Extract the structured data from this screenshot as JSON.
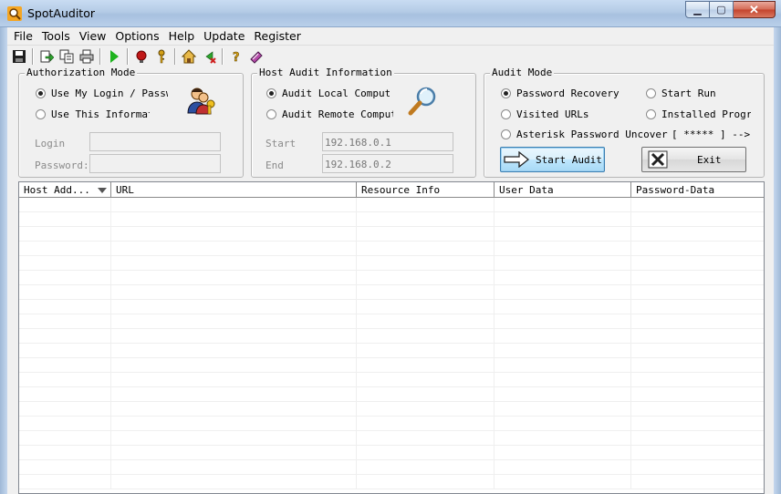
{
  "window": {
    "title": "SpotAuditor",
    "icon": "magnifier-key-icon"
  },
  "menu": [
    "File",
    "Tools",
    "View",
    "Options",
    "Help",
    "Update",
    "Register"
  ],
  "toolbar": [
    "save-icon",
    "import-icon",
    "copy-icon",
    "print-icon",
    "run-icon",
    "record-icon",
    "key-icon",
    "home-icon",
    "back-icon",
    "help-icon",
    "book-icon"
  ],
  "auth": {
    "legend": "Authorization Mode",
    "opt_my_login": "Use My Login / Password",
    "opt_this_info": "Use This Information",
    "login_label": "Login",
    "password_label": "Password:",
    "login_value": "",
    "password_value": ""
  },
  "host": {
    "legend": "Host Audit Information",
    "opt_local": "Audit Local Computer",
    "opt_remote": "Audit Remote Computer",
    "start_label": "Start",
    "end_label": "End",
    "start_value": "192.168.0.1",
    "end_value": "192.168.0.2"
  },
  "audit": {
    "legend": "Audit Mode",
    "opt_password_recovery": "Password Recovery",
    "opt_start_run": "Start Run",
    "opt_visited_urls": "Visited URLs",
    "opt_installed": "Installed Programs",
    "opt_asterisk": "Asterisk Password Uncover",
    "asterisk_hint": "[ ***** ] -->",
    "start_button": "Start Audit",
    "exit_button": "Exit"
  },
  "grid": {
    "columns": [
      "Host Add...",
      "URL",
      "Resource Info",
      "User Data",
      "Password-Data"
    ],
    "rows": []
  }
}
